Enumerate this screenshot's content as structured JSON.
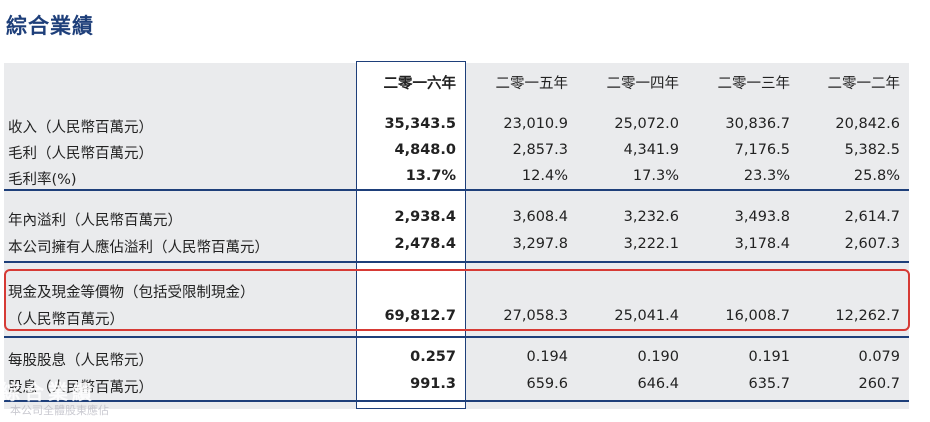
{
  "title": "綜合業績",
  "years": [
    "二零一六年",
    "二零一五年",
    "二零一四年",
    "二零一三年",
    "二零一二年"
  ],
  "rows": [
    {
      "label": "收入（人民幣百萬元）",
      "values": [
        "35,343.5",
        "23,010.9",
        "25,072.0",
        "30,836.7",
        "20,842.6"
      ]
    },
    {
      "label": "毛利（人民幣百萬元）",
      "values": [
        "4,848.0",
        "2,857.3",
        "4,341.9",
        "7,176.5",
        "5,382.5"
      ]
    },
    {
      "label": "毛利率(%)",
      "values": [
        "13.7%",
        "12.4%",
        "17.3%",
        "23.3%",
        "25.8%"
      ]
    },
    {
      "label": "年內溢利（人民幣百萬元）",
      "values": [
        "2,938.4",
        "3,608.4",
        "3,232.6",
        "3,493.8",
        "2,614.7"
      ]
    },
    {
      "label": "本公司擁有人應佔溢利（人民幣百萬元）",
      "values": [
        "2,478.4",
        "3,297.8",
        "3,222.1",
        "3,178.4",
        "2,607.3"
      ]
    },
    {
      "label": "現金及現金等價物（包括受限制現金）",
      "label2": "（人民幣百萬元）",
      "values": [
        "69,812.7",
        "27,058.3",
        "25,041.4",
        "16,008.7",
        "12,262.7"
      ]
    },
    {
      "label": "每股股息（人民幣元）",
      "values": [
        "0.257",
        "0.194",
        "0.190",
        "0.191",
        "0.079"
      ]
    },
    {
      "label": "股息（人民幣百萬元）",
      "values": [
        "991.3",
        "659.6",
        "646.4",
        "635.7",
        "260.7"
      ]
    }
  ],
  "watermark": "綜合業績",
  "watermark_sub": "本公司全體股東應佔"
}
